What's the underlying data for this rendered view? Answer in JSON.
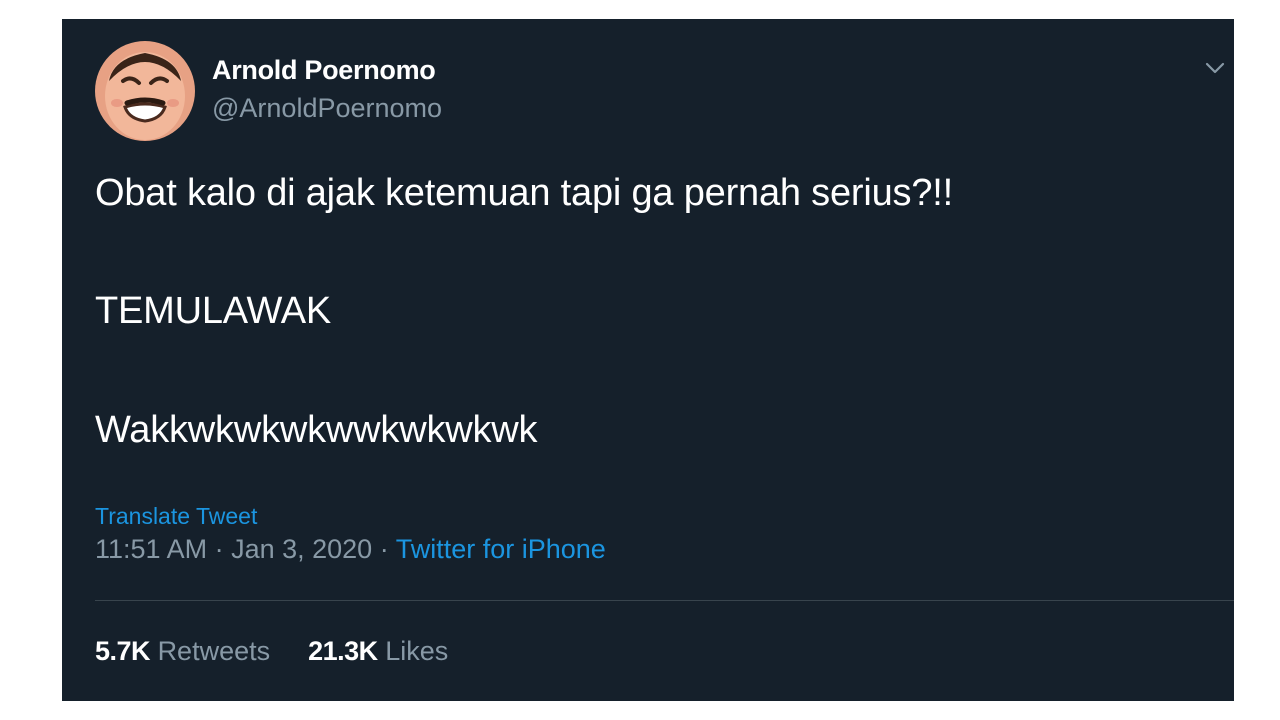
{
  "tweet": {
    "author": {
      "display_name": "Arnold Poernomo",
      "handle": "@ArnoldPoernomo"
    },
    "lines": [
      "Obat kalo di ajak ketemuan tapi ga pernah serius?!!",
      "TEMULAWAK",
      "Wakkwkwkwkwwkwkwkwk"
    ],
    "translate_label": "Translate Tweet",
    "time": "11:51 AM",
    "separator": " · ",
    "date": "Jan 3, 2020",
    "source": "Twitter for iPhone",
    "stats": {
      "retweets_count": "5.7K",
      "retweets_label": "Retweets",
      "likes_count": "21.3K",
      "likes_label": "Likes"
    }
  },
  "icons": {
    "caret": "chevron-down-icon",
    "avatar": "avatar"
  },
  "colors": {
    "background": "#15202b",
    "text_primary": "#ffffff",
    "text_secondary": "#8899a6",
    "link": "#1b95e0",
    "divider": "#38444d"
  }
}
